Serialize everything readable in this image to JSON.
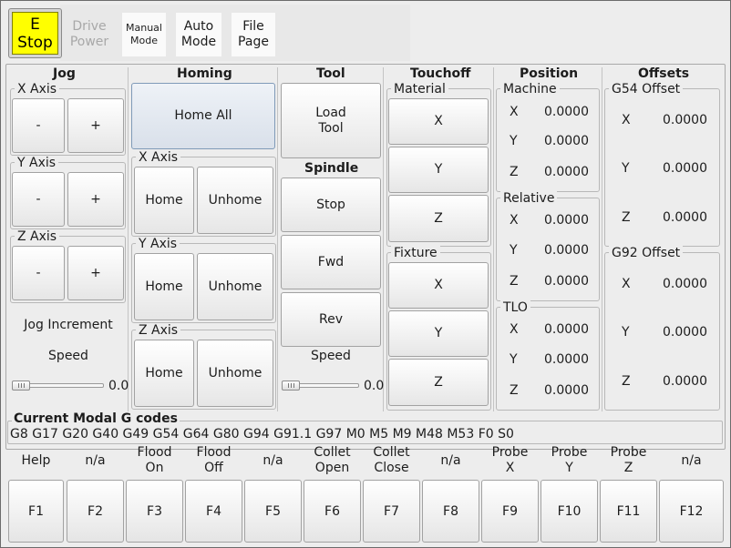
{
  "top_bar": {
    "estop_line1": "E",
    "estop_line2": "Stop",
    "drive_power_line1": "Drive",
    "drive_power_line2": "Power",
    "manual_mode_line1": "Manual",
    "manual_mode_line2": "Mode",
    "auto_mode_line1": "Auto",
    "auto_mode_line2": "Mode",
    "file_page_line1": "File",
    "file_page_line2": "Page"
  },
  "jog": {
    "title": "Jog",
    "x_axis_label": "X Axis",
    "y_axis_label": "Y Axis",
    "z_axis_label": "Z Axis",
    "minus_label": "-",
    "plus_label": "+",
    "increment_label": "Jog Increment",
    "speed_label": "Speed",
    "speed_value": "0.0",
    "speed_fraction": 0.0
  },
  "homing": {
    "title": "Homing",
    "home_all_label": "Home All",
    "x_axis_label": "X Axis",
    "y_axis_label": "Y Axis",
    "z_axis_label": "Z Axis",
    "home_label": "Home",
    "unhome_label": "Unhome"
  },
  "tool": {
    "title": "Tool",
    "load_tool_line1": "Load",
    "load_tool_line2": "Tool",
    "spindle_title": "Spindle",
    "stop_label": "Stop",
    "fwd_label": "Fwd",
    "rev_label": "Rev",
    "speed_label": "Speed",
    "speed_value": "0.0",
    "speed_fraction": 0.0
  },
  "touchoff": {
    "title": "Touchoff",
    "material_label": "Material",
    "fixture_label": "Fixture",
    "x_label": "X",
    "y_label": "Y",
    "z_label": "Z"
  },
  "position": {
    "title": "Position",
    "machine_label": "Machine",
    "relative_label": "Relative",
    "tlo_label": "TLO",
    "axis_x": "X",
    "axis_y": "Y",
    "axis_z": "Z",
    "machine": {
      "x": "0.0000",
      "y": "0.0000",
      "z": "0.0000"
    },
    "relative": {
      "x": "0.0000",
      "y": "0.0000",
      "z": "0.0000"
    },
    "tlo": {
      "x": "0.0000",
      "y": "0.0000",
      "z": "0.0000"
    }
  },
  "offsets": {
    "title": "Offsets",
    "g54_label": "G54 Offset",
    "g92_label": "G92 Offset",
    "axis_x": "X",
    "axis_y": "Y",
    "axis_z": "Z",
    "g54": {
      "x": "0.0000",
      "y": "0.0000",
      "z": "0.0000"
    },
    "g92": {
      "x": "0.0000",
      "y": "0.0000",
      "z": "0.0000"
    }
  },
  "modal": {
    "title": "Current Modal G codes",
    "codes": "G8 G17 G20 G40 G49 G54 G64 G80 G94 G91.1 G97 M0 M5 M9 M48 M53 F0 S0"
  },
  "function_labels": [
    {
      "l1": "Help",
      "l2": ""
    },
    {
      "l1": "n/a",
      "l2": ""
    },
    {
      "l1": "Flood",
      "l2": "On"
    },
    {
      "l1": "Flood",
      "l2": "Off"
    },
    {
      "l1": "n/a",
      "l2": ""
    },
    {
      "l1": "Collet",
      "l2": "Open"
    },
    {
      "l1": "Collet",
      "l2": "Close"
    },
    {
      "l1": "n/a",
      "l2": ""
    },
    {
      "l1": "Probe",
      "l2": "X"
    },
    {
      "l1": "Probe",
      "l2": "Y"
    },
    {
      "l1": "Probe",
      "l2": "Z"
    },
    {
      "l1": "n/a",
      "l2": ""
    }
  ],
  "function_keys": [
    "F1",
    "F2",
    "F3",
    "F4",
    "F5",
    "F6",
    "F7",
    "F8",
    "F9",
    "F10",
    "F11",
    "F12"
  ],
  "colors": {
    "estop": "#ffff00",
    "background": "#ededed"
  }
}
